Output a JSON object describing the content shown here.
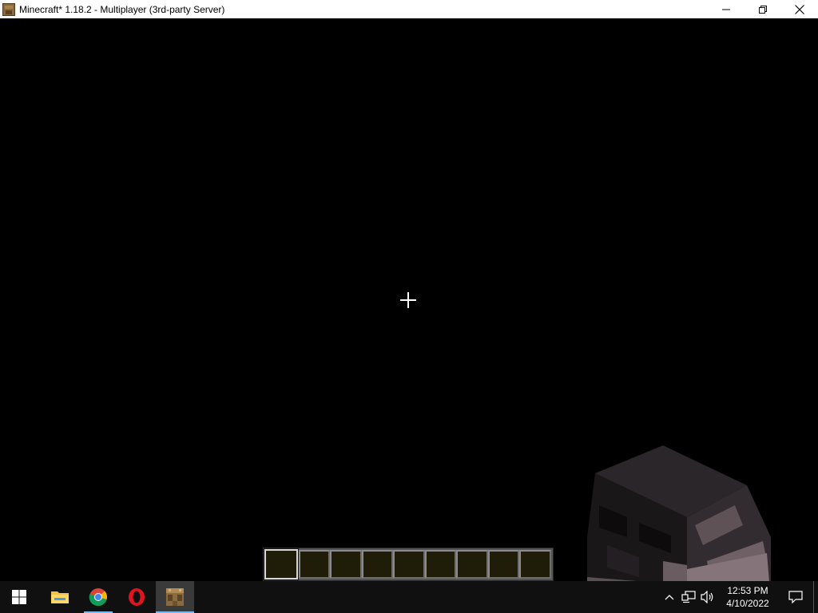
{
  "window": {
    "title": "Minecraft* 1.18.2 - Multiplayer (3rd-party Server)",
    "icon": "crafting-table-icon",
    "controls": [
      "minimize-icon",
      "restore-icon",
      "close-icon"
    ]
  },
  "game": {
    "hotbar": {
      "slot_count": 9,
      "selected_slot": 1
    }
  },
  "taskbar": {
    "pinned": [
      {
        "name": "start",
        "icon": "windows-logo-icon"
      },
      {
        "name": "file-explorer",
        "icon": "folder-icon"
      },
      {
        "name": "chrome",
        "icon": "chrome-icon",
        "running": true
      },
      {
        "name": "opera",
        "icon": "opera-icon"
      },
      {
        "name": "minecraft",
        "icon": "crafting-table-icon",
        "running": true,
        "active": true
      }
    ],
    "tray": {
      "icons": [
        "chevron-up-icon",
        "network-icon",
        "volume-icon"
      ],
      "time": "12:53 PM",
      "date": "4/10/2022",
      "notification_icon": "notification-icon"
    }
  },
  "colors": {
    "accent": "#76b9ed",
    "taskbar_bg": "#101010",
    "titlebar_bg": "#ffffff"
  }
}
